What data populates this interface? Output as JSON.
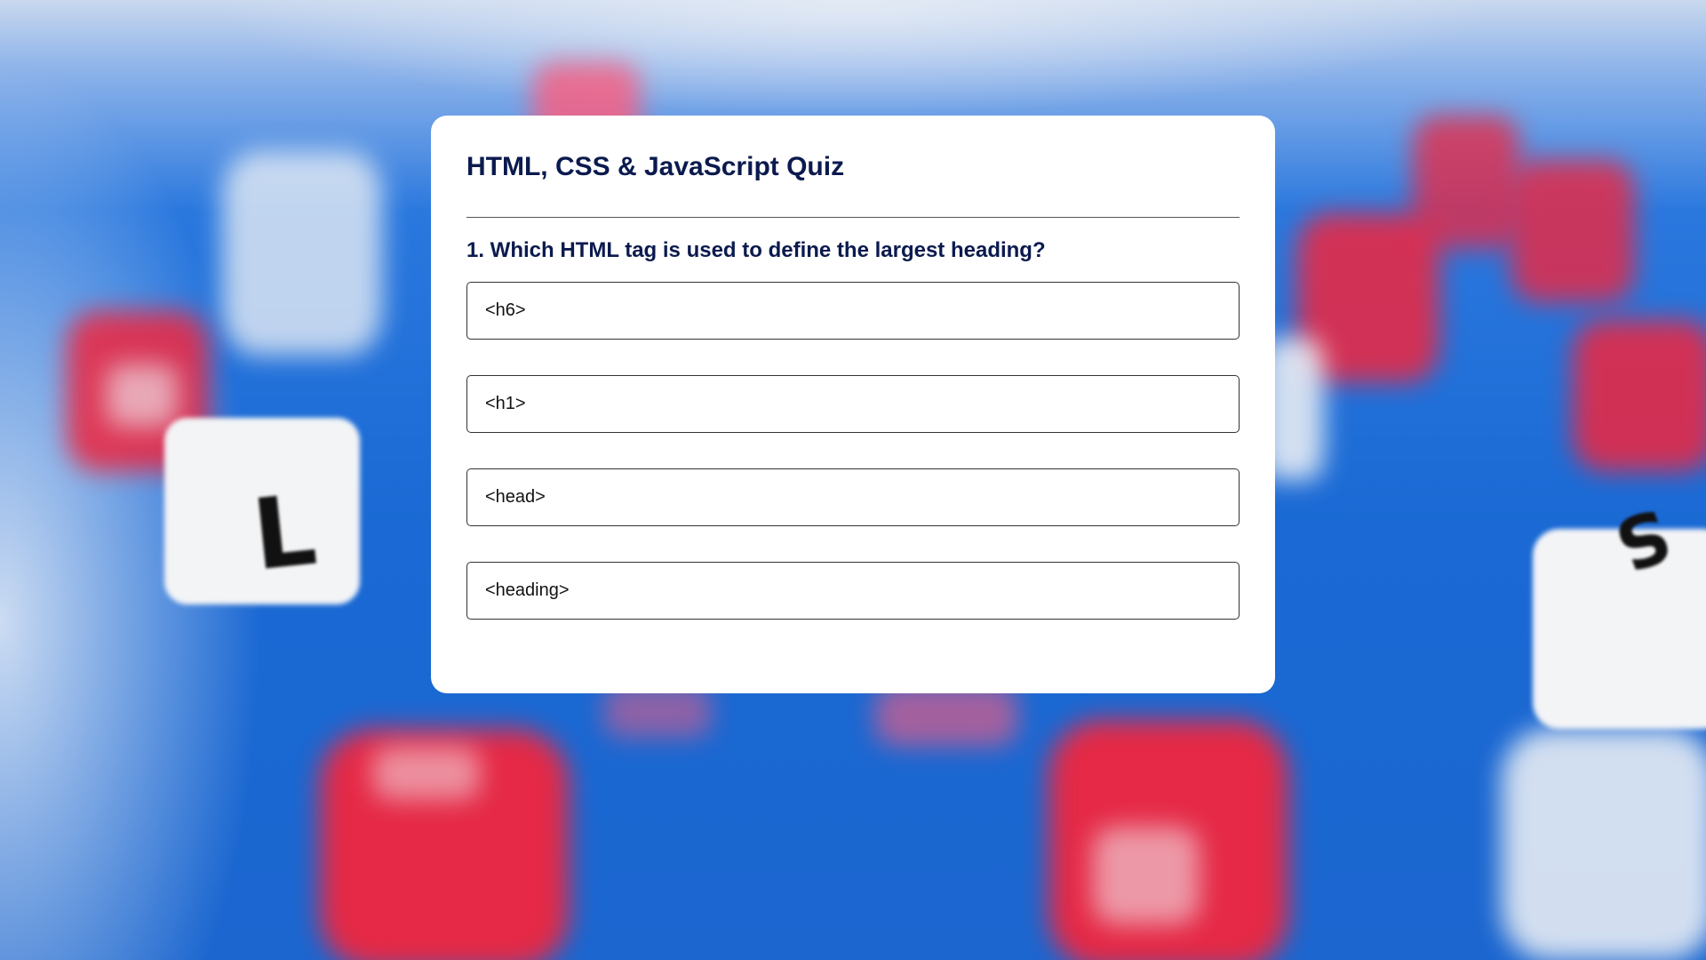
{
  "quiz": {
    "title": "HTML, CSS & JavaScript Quiz",
    "question": "1. Which HTML tag is used to define the largest heading?",
    "options": [
      "<h6>",
      "<h1>",
      "<head>",
      "<heading>"
    ]
  },
  "background": {
    "description_icons": [
      "letter-die-l",
      "letter-die-s"
    ],
    "die_letters": [
      "L",
      "S"
    ]
  },
  "colors": {
    "title": "#0b1a4e",
    "background_blue": "#1b66cf",
    "die_red": "#f0263f"
  }
}
